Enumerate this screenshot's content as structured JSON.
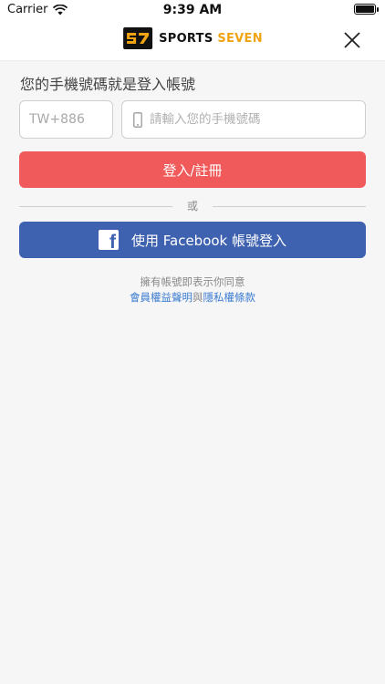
{
  "status_bar": {
    "carrier": "Carrier",
    "time": "9:39 AM"
  },
  "nav": {
    "brand": {
      "logo_icon": "s7-logo-icon",
      "sports": "SPORTS",
      "seven": "SEVEN"
    },
    "close_icon": "close-icon"
  },
  "login": {
    "title": "您的手機號碼就是登入帳號",
    "country_code": "TW+886",
    "phone_placeholder": "請輸入您的手機號碼",
    "phone_value": "",
    "register_label": "登入/註冊",
    "or_label": "或",
    "facebook_label": "使用 Facebook 帳號登入"
  },
  "terms": {
    "text": "擁有帳號即表示你同意",
    "member_rights": "會員權益聲明",
    "and": "與",
    "privacy": "隱私權條款"
  },
  "colors": {
    "register_button": "#f15a5a",
    "facebook_button": "#3e61b0",
    "link": "#3b7bd1",
    "brand_accent": "#f0a414"
  }
}
